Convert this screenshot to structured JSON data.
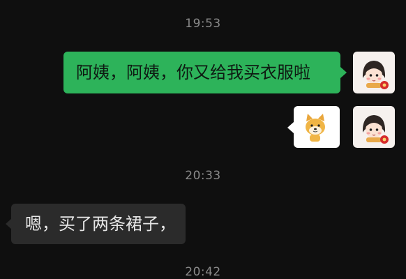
{
  "chat": {
    "timestamps": [
      "19:53",
      "20:33",
      "20:42"
    ],
    "messages": [
      {
        "side": "right",
        "type": "text",
        "text": "阿姨，阿姨，你又给我买衣服啦",
        "bubble_color": "#2db35a"
      },
      {
        "side": "right",
        "type": "sticker",
        "sticker_icon": "shiba-dog-sticker"
      },
      {
        "side": "left",
        "type": "text",
        "text": "嗯，买了两条裙子，",
        "bubble_color": "#2b2b2b"
      }
    ],
    "self_avatar_icon": "girl-avatar-icon"
  },
  "colors": {
    "background": "#0f0f0f",
    "timestamp": "#8a8a8a",
    "sent_bubble": "#2db35a",
    "received_bubble": "#2b2b2b"
  }
}
